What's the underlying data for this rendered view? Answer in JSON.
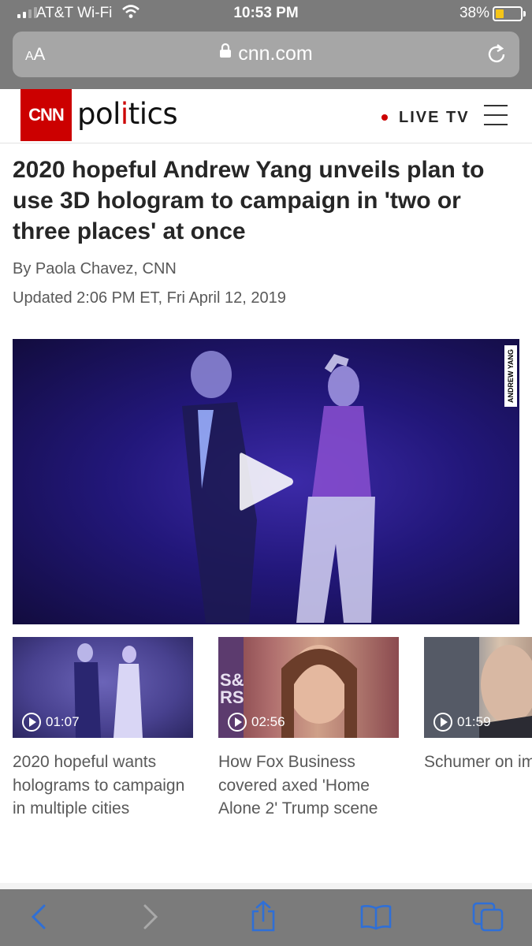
{
  "status_bar": {
    "carrier": "AT&T Wi-Fi",
    "time": "10:53 PM",
    "battery": "38%",
    "battery_level": 0.38
  },
  "browser": {
    "text_size_button": "AA",
    "url": "cnn.com"
  },
  "site_header": {
    "logo": "CNN",
    "section_pre": "pol",
    "section_i": "i",
    "section_post": "tics",
    "live_tv": "LIVE TV"
  },
  "article": {
    "headline": "2020 hopeful Andrew Yang unveils plan to use 3D hologram to campaign in 'two or three places' at once",
    "byline": "By Paola Chavez, CNN",
    "updated": "Updated 2:06 PM ET, Fri April 12, 2019",
    "video_watermark": "ANDREW YANG"
  },
  "related_videos": [
    {
      "duration": "01:07",
      "caption": "2020 hopeful wants holograms to campaign in multiple cities"
    },
    {
      "duration": "02:56",
      "caption": "How Fox Business covered axed 'Home Alone 2' Trump scene"
    },
    {
      "duration": "01:59",
      "caption": "Schumer on impeachment: Senate not lik"
    }
  ],
  "icons": {
    "toolbar": [
      "back-icon",
      "forward-icon",
      "share-icon",
      "bookmarks-icon",
      "tabs-icon"
    ],
    "header": [
      "lock-icon",
      "reload-icon",
      "hamburger-menu-icon"
    ]
  },
  "colors": {
    "cnn_red": "#cc0000",
    "ios_blue": "#2f6fd6",
    "chrome_gray": "#7b7b7b"
  }
}
